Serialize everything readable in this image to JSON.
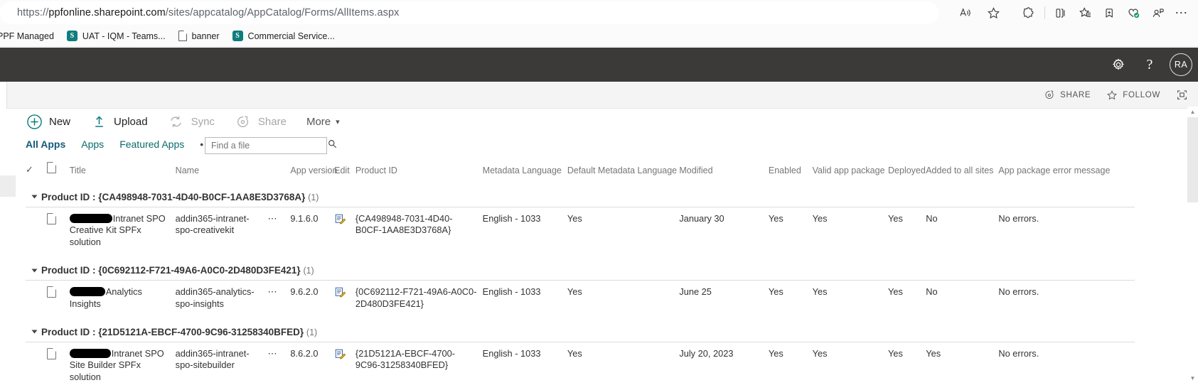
{
  "browser": {
    "url_prefix": "https://",
    "url_domain": "ppfonline.sharepoint.com",
    "url_path": "/sites/appcatalog/AppCatalog/Forms/AllItems.aspx",
    "toolbar_icons": [
      "read-aloud-icon",
      "favorite-star-icon",
      "extensions-icon",
      "split-screen-icon",
      "collections-icon",
      "add-favorite-icon",
      "browser-essentials-icon",
      "profile-icon",
      "settings-more-icon"
    ],
    "bookmarks": [
      {
        "label": "PPF Managed",
        "icon": "none"
      },
      {
        "label": "UAT - IQM - Teams...",
        "icon": "sharepoint-badge",
        "badge": "S"
      },
      {
        "label": "banner",
        "icon": "document-badge"
      },
      {
        "label": "Commercial Service...",
        "icon": "sharepoint-badge",
        "badge": "S"
      }
    ]
  },
  "suitebar": {
    "settings_icon": "gear-icon",
    "help_label": "?",
    "avatar_initials": "RA"
  },
  "sitebar": {
    "share_label": "SHARE",
    "follow_label": "FOLLOW",
    "focus_icon": "focus-on-content-icon"
  },
  "toolbar": {
    "new_label": "New",
    "upload_label": "Upload",
    "sync_label": "Sync",
    "share_label": "Share",
    "more_label": "More",
    "accent_color": "#0b7b7b"
  },
  "views": {
    "tabs": [
      {
        "label": "All Apps",
        "active": true
      },
      {
        "label": "Apps",
        "active": false
      },
      {
        "label": "Featured Apps",
        "active": false
      },
      {
        "label": "•••",
        "active": false
      }
    ],
    "search_placeholder": "Find a file",
    "search_value": ""
  },
  "list": {
    "columns": [
      "Title",
      "Name",
      "App version",
      "Edit",
      "Product ID",
      "Metadata Language",
      "Default Metadata Language",
      "Modified",
      "Enabled",
      "Valid app package",
      "Deployed",
      "Added to all sites",
      "App package error message"
    ],
    "groups": [
      {
        "label_prefix": "Product ID : ",
        "label_value": "{CA498948-7031-4D40-B0CF-1AA8E3D3768A}",
        "count": "(1)",
        "rows": [
          {
            "title_redacted": true,
            "title": "Intranet SPO Creative Kit SPFx solution",
            "name": "addin365-intranet-spo-creativekit",
            "app_version": "9.1.6.0",
            "product_id": "{CA498948-7031-4D40-B0CF-1AA8E3D3768A}",
            "metadata_language": "English - 1033",
            "default_metadata_language": "Yes",
            "modified": "January 30",
            "enabled": "Yes",
            "valid_app_package": "Yes",
            "deployed": "Yes",
            "added_to_all_sites": "No",
            "app_package_error_message": "No errors."
          }
        ]
      },
      {
        "label_prefix": "Product ID : ",
        "label_value": "{0C692112-F721-49A6-A0C0-2D480D3FE421}",
        "count": "(1)",
        "rows": [
          {
            "title_redacted": true,
            "title": "Analytics Insights",
            "name": "addin365-analytics-spo-insights",
            "app_version": "9.6.2.0",
            "product_id": "{0C692112-F721-49A6-A0C0-2D480D3FE421}",
            "metadata_language": "English - 1033",
            "default_metadata_language": "Yes",
            "modified": "June 25",
            "enabled": "Yes",
            "valid_app_package": "Yes",
            "deployed": "Yes",
            "added_to_all_sites": "No",
            "app_package_error_message": "No errors."
          }
        ]
      },
      {
        "label_prefix": "Product ID : ",
        "label_value": "{21D5121A-EBCF-4700-9C96-31258340BFED}",
        "count": "(1)",
        "rows": [
          {
            "title_redacted": true,
            "title": "Intranet SPO Site Builder SPFx solution",
            "name": "addin365-intranet-spo-sitebuilder",
            "app_version": "8.6.2.0",
            "product_id": "{21D5121A-EBCF-4700-9C96-31258340BFED}",
            "metadata_language": "English - 1033",
            "default_metadata_language": "Yes",
            "modified": "July 20, 2023",
            "enabled": "Yes",
            "valid_app_package": "Yes",
            "deployed": "Yes",
            "added_to_all_sites": "Yes",
            "app_package_error_message": "No errors."
          }
        ]
      }
    ]
  }
}
